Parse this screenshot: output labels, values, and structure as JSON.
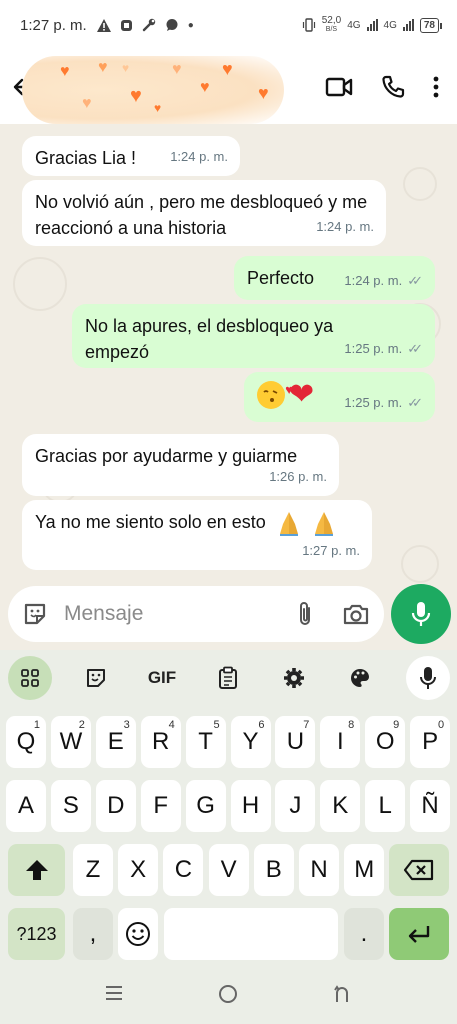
{
  "status_bar": {
    "time": "1:27 p. m.",
    "speed_value": "52,0",
    "speed_unit": "B/S",
    "network_1": "4G",
    "network_2": "4G",
    "battery": "78"
  },
  "header": {
    "icons": [
      "back-arrow-icon",
      "video-call-icon",
      "phone-call-icon",
      "more-options-icon"
    ]
  },
  "messages": [
    {
      "direction": "in",
      "text": "Gracias Lia !",
      "time": "1:24 p. m."
    },
    {
      "direction": "in",
      "text": "No volvió aún , pero me desbloqueó y me reaccionó a una historia",
      "time": "1:24 p. m."
    },
    {
      "direction": "out",
      "text": "Perfecto",
      "time": "1:24 p. m."
    },
    {
      "direction": "out",
      "text": "No la apures, el desbloqueo ya empezó",
      "time": "1:25 p. m."
    },
    {
      "direction": "out",
      "text": "",
      "emoji": [
        "face-blowing-kiss",
        "red-heart"
      ],
      "time": "1:25 p. m."
    },
    {
      "direction": "in",
      "text": "Gracias por ayudarme y guiarme",
      "time": "1:26 p. m."
    },
    {
      "direction": "in",
      "text": "Ya no me siento solo en esto",
      "emoji": [
        "folded-hands",
        "folded-hands"
      ],
      "time": "1:27 p. m."
    }
  ],
  "composer": {
    "placeholder": "Mensaje"
  },
  "keyboard": {
    "toolbar": {
      "gif_label": "GIF"
    },
    "row1": [
      {
        "k": "Q",
        "n": "1"
      },
      {
        "k": "W",
        "n": "2"
      },
      {
        "k": "E",
        "n": "3"
      },
      {
        "k": "R",
        "n": "4"
      },
      {
        "k": "T",
        "n": "5"
      },
      {
        "k": "Y",
        "n": "6"
      },
      {
        "k": "U",
        "n": "7"
      },
      {
        "k": "I",
        "n": "8"
      },
      {
        "k": "O",
        "n": "9"
      },
      {
        "k": "P",
        "n": "0"
      }
    ],
    "row2": [
      "A",
      "S",
      "D",
      "F",
      "G",
      "H",
      "J",
      "K",
      "L",
      "Ñ"
    ],
    "row3": [
      "Z",
      "X",
      "C",
      "V",
      "B",
      "N",
      "M"
    ],
    "row4": {
      "symbols": "?123",
      "comma": ",",
      "period": "."
    }
  },
  "colors": {
    "outgoing_bubble": "#d9fdd3",
    "incoming_bubble": "#ffffff",
    "chat_background": "#f1ede4",
    "accent_green": "#1daa61"
  }
}
